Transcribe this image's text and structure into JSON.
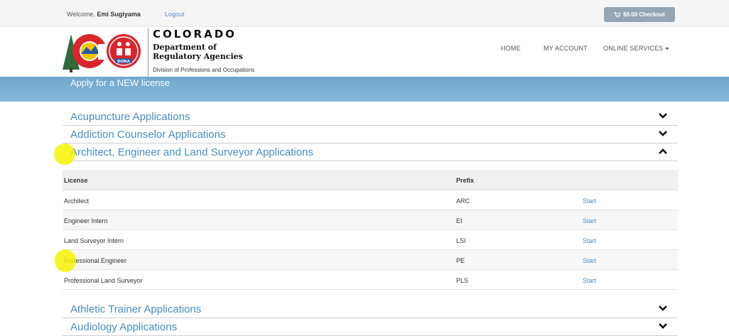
{
  "topbar": {
    "welcome_prefix": "Welcome,",
    "user_name": "Emi Sugiyama",
    "logout": "Logout",
    "checkout": "$0.00 Checkout"
  },
  "header": {
    "state": "COLORADO",
    "department_line1": "Department of",
    "department_line2": "Regulatory Agencies",
    "division": "Division of Professions and Occupations",
    "logo_badge": "DORA",
    "nav": [
      "HOME",
      "MY ACCOUNT",
      "ONLINE SERVICES"
    ]
  },
  "banner": {
    "title": "Apply for a NEW license"
  },
  "accordion": [
    {
      "label": "Acupuncture Applications",
      "expanded": false
    },
    {
      "label": "Addiction Counselor Applications",
      "expanded": false
    },
    {
      "label": "Architect, Engineer and Land Surveyor Applications",
      "expanded": true
    },
    {
      "label": "Athletic Trainer Applications",
      "expanded": false
    },
    {
      "label": "Audiology Applications",
      "expanded": false
    }
  ],
  "table": {
    "headers": [
      "License",
      "Prefix"
    ],
    "rows": [
      {
        "license": "Architect",
        "prefix": "ARC",
        "action": "Start"
      },
      {
        "license": "Engineer Intern",
        "prefix": "EI",
        "action": "Start"
      },
      {
        "license": "Land Surveyor Intern",
        "prefix": "LSI",
        "action": "Start"
      },
      {
        "license": "Professional Engineer",
        "prefix": "PE",
        "action": "Start"
      },
      {
        "license": "Professional Land Surveyor",
        "prefix": "PLS",
        "action": "Start"
      }
    ]
  },
  "colors": {
    "link_blue": "#4a8ec2",
    "banner_blue": "#7ab0d2",
    "checkout_gray": "#95a5b4",
    "highlight_yellow": "#f4f400"
  },
  "icons": [
    "cart-icon",
    "chevron-down-icon",
    "chevron-up-icon",
    "caret-down-icon",
    "colorado-logo",
    "dora-logo"
  ]
}
